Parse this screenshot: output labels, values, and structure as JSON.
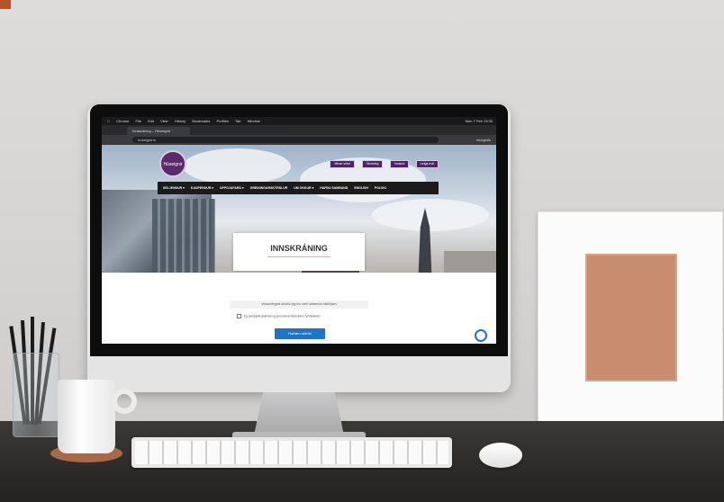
{
  "scene": {
    "description_tag": "desk-photo-with-imac",
    "colors": {
      "wall": "#d9d7d6",
      "desk": "#2b2a28",
      "accent_purple": "#4e2563",
      "button_blue": "#1e74c6",
      "frame_mat": "#c98c6f"
    }
  },
  "browser": {
    "menubar": [
      "Chrome",
      "File",
      "Edit",
      "View",
      "History",
      "Bookmarks",
      "Profiles",
      "Tab",
      "Window",
      "Help"
    ],
    "clock": "Mon 7 Feb 13:30",
    "tab_title": "Innskráning – Húseignir",
    "url": "huseignir.is",
    "profile": "Incognito"
  },
  "site": {
    "logo_text": "Húseignir",
    "top_buttons": [
      "Mínar síður",
      "Skráning",
      "Innskrá",
      "Leiga.mál"
    ],
    "nav": [
      "SELJENDUR ▾",
      "KAUPENDUR ▾",
      "UPPGJAFARÁ ▾",
      "GREININGARSKÝRSLUR",
      "UM OKKUR ▾",
      "HAFÐU SAMBAND",
      "ENGLISH",
      "POLSKI"
    ],
    "page_title": "INNSKRÁNING",
    "info_message": "Vinsamlegast skráðu þig inn með rafrænum skilríkjum",
    "checkbox_text": "Ég samþykki skilmála og persónuverndarstefnu fyrirtækisins",
    "login_button": "Rafræn skilríki",
    "chat_icon": "messenger-icon"
  }
}
